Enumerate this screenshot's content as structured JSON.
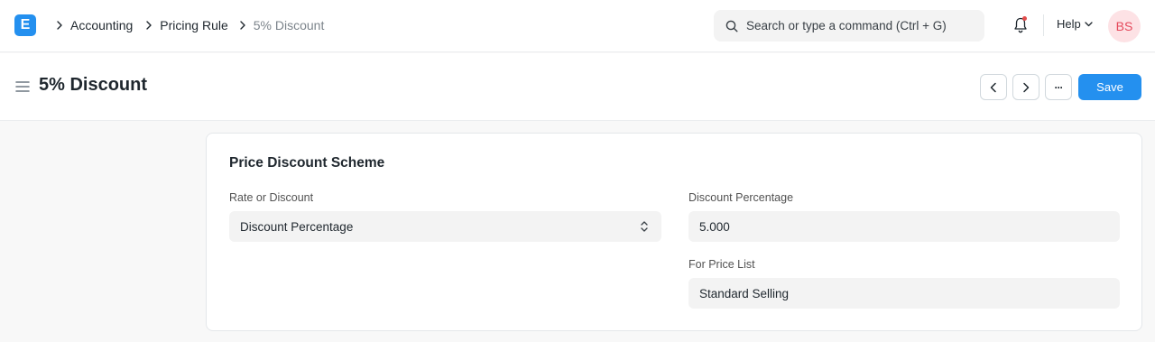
{
  "navbar": {
    "logo_letter": "E",
    "breadcrumbs": [
      "Accounting",
      "Pricing Rule",
      "5% Discount"
    ],
    "search_placeholder": "Search or type a command (Ctrl + G)",
    "help_label": "Help",
    "avatar_initials": "BS"
  },
  "page": {
    "title": "5% Discount",
    "save_label": "Save",
    "more_label": "···"
  },
  "section": {
    "title": "Price Discount Scheme",
    "fields": {
      "rate_or_discount": {
        "label": "Rate or Discount",
        "value": "Discount Percentage"
      },
      "discount_percentage": {
        "label": "Discount Percentage",
        "value": "5.000"
      },
      "for_price_list": {
        "label": "For Price List",
        "value": "Standard Selling"
      }
    }
  },
  "colors": {
    "primary": "#2490ef",
    "avatar_bg": "#fde2e5",
    "avatar_text": "#e5485b",
    "notification_dot": "#e24c4c"
  }
}
